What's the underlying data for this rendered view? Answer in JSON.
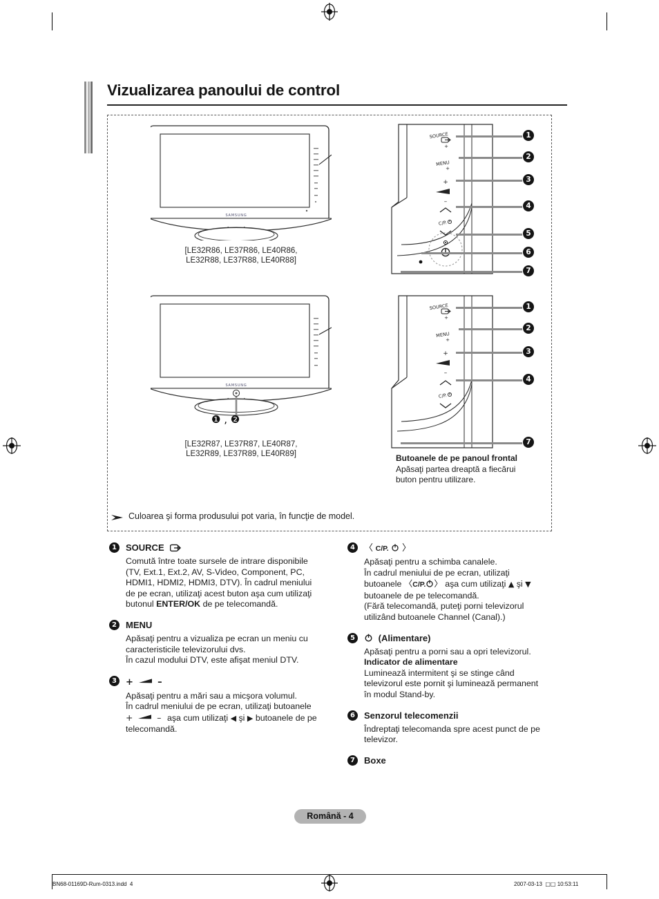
{
  "heading": "Vizualizarea panoului de control",
  "diagram": {
    "figure1_models": "[LE32R86, LE37R86, LE40R86,\nLE32R88, LE37R88, LE40R88]",
    "figure2_models": "[LE32R87, LE37R87, LE40R87,\nLE32R89, LE37R89, LE40R89]",
    "figure2_callout_pair": "❶ , ❷",
    "panel_labels": {
      "source": "SOURCE",
      "menu": "MENU",
      "volume_plus": "+",
      "volume_minus": "–",
      "channel": "C/P.",
      "brand": "SAMSUNG"
    },
    "callout_numbers": [
      "1",
      "2",
      "3",
      "4",
      "5",
      "6",
      "7"
    ],
    "panel_caption_title": "Butoanele de pe panoul frontal",
    "panel_caption_text": "Apăsaţi partea dreaptă a fiecărui\nbuton pentru utilizare.",
    "note": "Culoarea şi forma produsului pot varia, în funcţie de model."
  },
  "items": {
    "item1": {
      "num": "1",
      "title": "SOURCE",
      "icon": "source-icon",
      "body_l1": "Comută între toate sursele de intrare disponibile",
      "body_l2": "(TV, Ext.1, Ext.2, AV, S-Video, Component, PC,",
      "body_l3": "HDMI1, HDMI2, HDMI3, DTV). În cadrul meniului",
      "body_l4": "de pe ecran, utilizaţi acest buton aşa cum utilizaţi",
      "body_l5_pre": "butonul ",
      "body_l5_bold": "ENTER/OK",
      "body_l5_post": " de pe telecomandă."
    },
    "item2": {
      "num": "2",
      "title": "MENU",
      "body_l1": "Apăsaţi pentru a vizualiza pe ecran un meniu cu",
      "body_l2": "caracteristicile televizorului dvs.",
      "body_l3": "În cazul modului DTV, este afişat meniul DTV."
    },
    "item3": {
      "num": "3",
      "title_plus": "+",
      "title_minus": "–",
      "body_l1": "Apăsaţi pentru a mări sau a micşora volumul.",
      "body_l2": "În cadrul meniului de pe ecran, utilizaţi butoanele",
      "body_l3_a": "+",
      "body_l3_b": "–",
      "body_l3_c": "aşa cum utilizaţi",
      "body_l3_d": "◀",
      "body_l3_e": "şi",
      "body_l3_f": "▶",
      "body_l3_g": "butoanele de pe",
      "body_l4": "telecomandă."
    },
    "item4": {
      "num": "4",
      "title_lt": "〈",
      "title_cp": "C/P.",
      "title_pw": "power-icon",
      "title_gt": "〉",
      "body_l1": "Apăsaţi pentru a schimba canalele.",
      "body_l2": "În cadrul meniului de pe ecran, utilizaţi",
      "body_l3_pre": "butoanele",
      "body_l3_cp": "C/P.",
      "body_l3_up": "▲",
      "body_l3_mid": "aşa cum utilizaţi",
      "body_l3_and": "şi",
      "body_l3_dn": "▼",
      "body_l4": "butoanele de pe telecomandă.",
      "body_l5": "(Fără telecomandă, puteţi porni televizorul",
      "body_l6": "utilizând butoanele Channel (Canal).)"
    },
    "item5": {
      "num": "5",
      "title": "(Alimentare)",
      "icon": "power-icon",
      "body_l1": "Apăsaţi pentru a porni sau a opri televizorul.",
      "body_sub": "Indicator de alimentare",
      "body_l2": "Luminează intermitent şi se stinge când",
      "body_l3": "televizorul este pornit şi luminează permanent",
      "body_l4": "în modul Stand-by."
    },
    "item6": {
      "num": "6",
      "title": "Senzorul telecomenzii",
      "body_l1": "Îndreptaţi telecomanda spre acest punct de pe",
      "body_l2": "televizor."
    },
    "item7": {
      "num": "7",
      "title": "Boxe"
    }
  },
  "footer": {
    "page_badge": "Română - 4",
    "file_name": "BN68-01169D-Rum-0313.indd",
    "file_page": "4",
    "date": "2007-03-13",
    "missing_glyphs": "□□",
    "time": "10:53:11"
  }
}
